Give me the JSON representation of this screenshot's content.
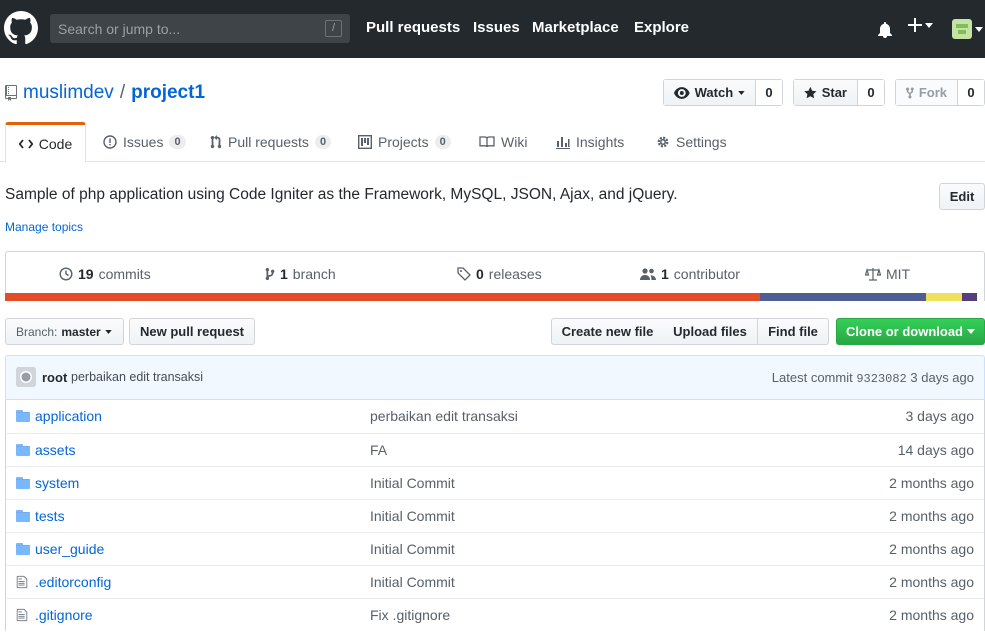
{
  "header": {
    "search_placeholder": "Search or jump to...",
    "search_key": "/",
    "nav": [
      "Pull requests",
      "Issues",
      "Marketplace",
      "Explore"
    ]
  },
  "repo": {
    "owner": "muslimdev",
    "separator": "/",
    "name": "project1",
    "watch_label": "Watch",
    "watch_count": "0",
    "star_label": "Star",
    "star_count": "0",
    "fork_label": "Fork",
    "fork_count": "0"
  },
  "tabs": [
    {
      "label": "Code"
    },
    {
      "label": "Issues",
      "count": "0"
    },
    {
      "label": "Pull requests",
      "count": "0"
    },
    {
      "label": "Projects",
      "count": "0"
    },
    {
      "label": "Wiki"
    },
    {
      "label": "Insights"
    },
    {
      "label": "Settings"
    }
  ],
  "description": "Sample of php application using Code Igniter as the Framework, MySQL, JSON, Ajax, and jQuery.",
  "edit_label": "Edit",
  "manage_topics": "Manage topics",
  "summary": {
    "commits_num": "19",
    "commits_label": "commits",
    "branch_num": "1",
    "branch_label": "branch",
    "releases_num": "0",
    "releases_label": "releases",
    "contributor_num": "1",
    "contributor_label": "contributor",
    "license": "MIT"
  },
  "languages": [
    {
      "color": "#e34c26",
      "percent": 77
    },
    {
      "color": "#4f5d95",
      "percent": 17
    },
    {
      "color": "#f1e05a",
      "percent": 3.7
    },
    {
      "color": "#563d7c",
      "percent": 1.5
    }
  ],
  "file_nav": {
    "branch_prefix": "Branch:",
    "branch_name": "master",
    "new_pr": "New pull request",
    "create_file": "Create new file",
    "upload_files": "Upload files",
    "find_file": "Find file",
    "clone": "Clone or download"
  },
  "commit": {
    "author": "root",
    "message": "perbaikan edit transaksi",
    "latest_label": "Latest commit",
    "sha": "9323082",
    "age": "3 days ago"
  },
  "files": [
    {
      "type": "dir",
      "name": "application",
      "message": "perbaikan edit transaksi",
      "age": "3 days ago"
    },
    {
      "type": "dir",
      "name": "assets",
      "message": "FA",
      "age": "14 days ago"
    },
    {
      "type": "dir",
      "name": "system",
      "message": "Initial Commit",
      "age": "2 months ago"
    },
    {
      "type": "dir",
      "name": "tests",
      "message": "Initial Commit",
      "age": "2 months ago"
    },
    {
      "type": "dir",
      "name": "user_guide",
      "message": "Initial Commit",
      "age": "2 months ago"
    },
    {
      "type": "file",
      "name": ".editorconfig",
      "message": "Initial Commit",
      "age": "2 months ago"
    },
    {
      "type": "file",
      "name": ".gitignore",
      "message": "Fix .gitignore",
      "age": "2 months ago"
    }
  ]
}
